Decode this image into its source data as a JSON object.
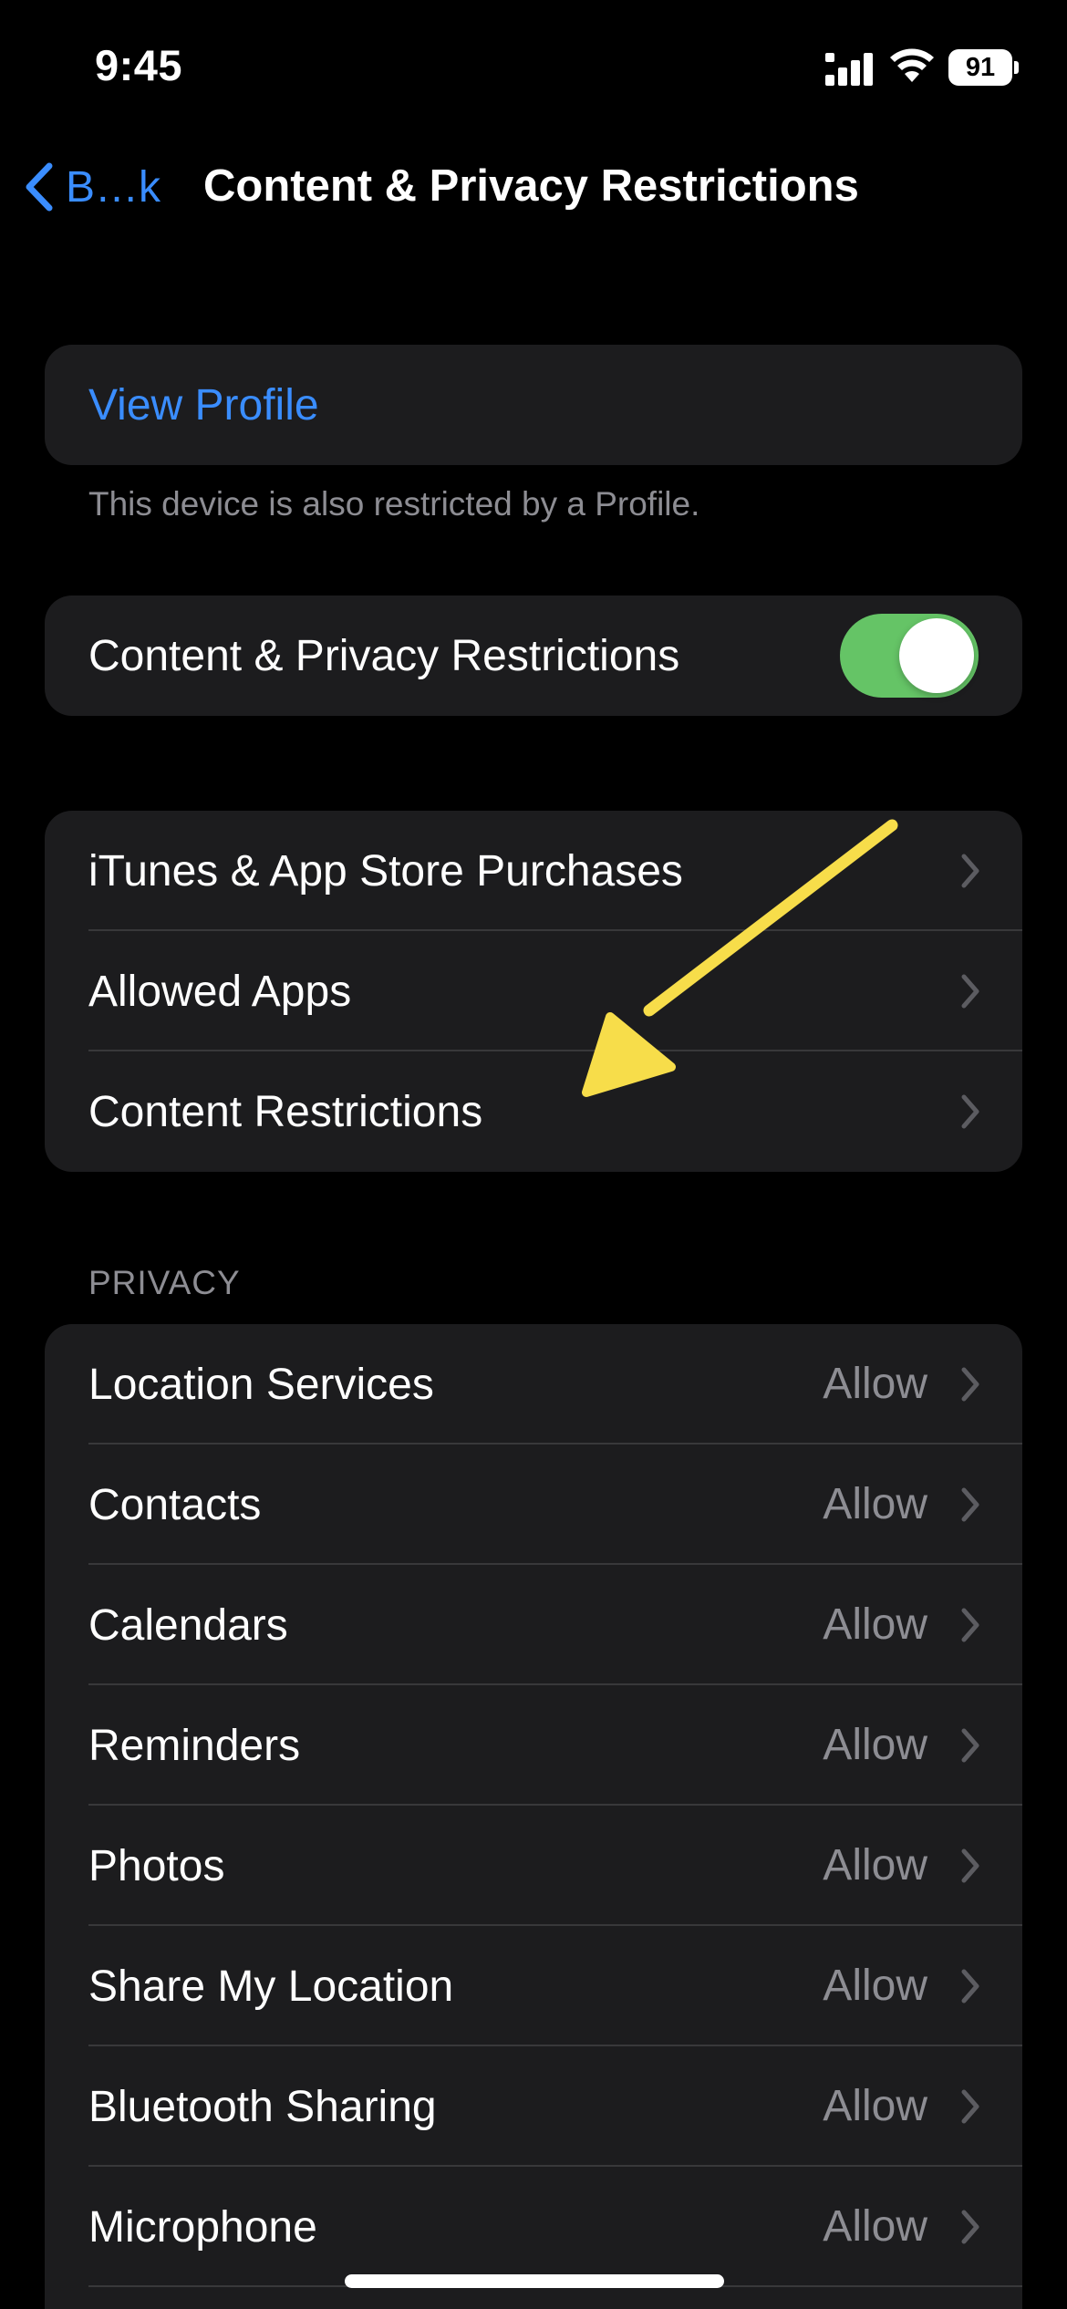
{
  "status_bar": {
    "time": "9:45",
    "battery_level": "91",
    "signal_icon": "cellular-signal-icon",
    "wifi_icon": "wifi-icon",
    "battery_icon": "battery-icon"
  },
  "nav": {
    "back_label": "B…k",
    "title": "Content & Privacy Restrictions"
  },
  "profile_group": {
    "link_label": "View Profile",
    "footer": "This device is also restricted by a Profile."
  },
  "toggle_group": {
    "label": "Content & Privacy Restrictions",
    "enabled": true
  },
  "restrictions_group": {
    "items": [
      {
        "label": "iTunes & App Store Purchases"
      },
      {
        "label": "Allowed Apps"
      },
      {
        "label": "Content Restrictions"
      }
    ]
  },
  "privacy_group": {
    "header": "PRIVACY",
    "items": [
      {
        "label": "Location Services",
        "value": "Allow"
      },
      {
        "label": "Contacts",
        "value": "Allow"
      },
      {
        "label": "Calendars",
        "value": "Allow"
      },
      {
        "label": "Reminders",
        "value": "Allow"
      },
      {
        "label": "Photos",
        "value": "Allow"
      },
      {
        "label": "Share My Location",
        "value": "Allow"
      },
      {
        "label": "Bluetooth Sharing",
        "value": "Allow"
      },
      {
        "label": "Microphone",
        "value": "Allow"
      }
    ]
  },
  "colors": {
    "accent_blue": "#3a8dff",
    "toggle_on": "#65c466",
    "annotation_arrow": "#f7dd4a",
    "cell_background": "#1c1c1e",
    "secondary_text": "#8d8d93"
  },
  "annotation": {
    "icon": "arrow-icon",
    "points_to": "Content Restrictions"
  }
}
